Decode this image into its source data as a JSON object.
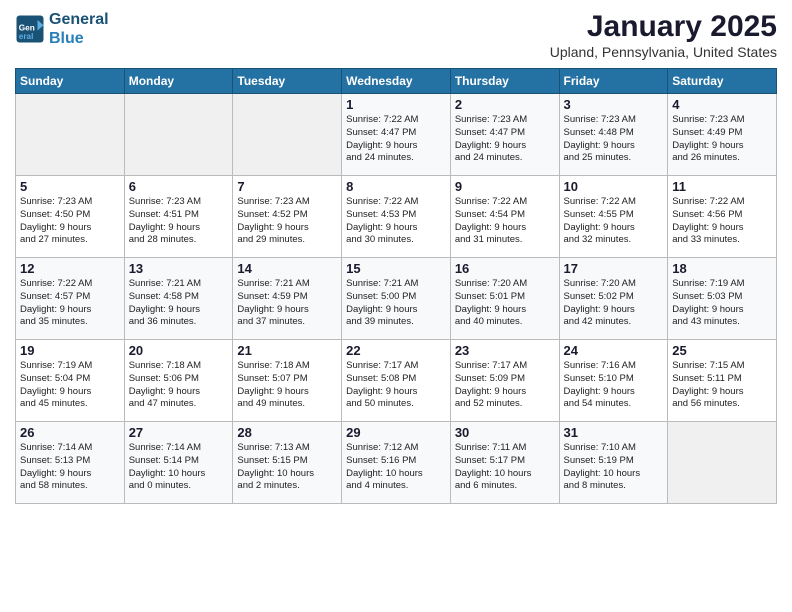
{
  "header": {
    "logo_line1": "General",
    "logo_line2": "Blue",
    "month_title": "January 2025",
    "location": "Upland, Pennsylvania, United States"
  },
  "weekdays": [
    "Sunday",
    "Monday",
    "Tuesday",
    "Wednesday",
    "Thursday",
    "Friday",
    "Saturday"
  ],
  "weeks": [
    [
      {
        "day": "",
        "info": ""
      },
      {
        "day": "",
        "info": ""
      },
      {
        "day": "",
        "info": ""
      },
      {
        "day": "1",
        "info": "Sunrise: 7:22 AM\nSunset: 4:47 PM\nDaylight: 9 hours\nand 24 minutes."
      },
      {
        "day": "2",
        "info": "Sunrise: 7:23 AM\nSunset: 4:47 PM\nDaylight: 9 hours\nand 24 minutes."
      },
      {
        "day": "3",
        "info": "Sunrise: 7:23 AM\nSunset: 4:48 PM\nDaylight: 9 hours\nand 25 minutes."
      },
      {
        "day": "4",
        "info": "Sunrise: 7:23 AM\nSunset: 4:49 PM\nDaylight: 9 hours\nand 26 minutes."
      }
    ],
    [
      {
        "day": "5",
        "info": "Sunrise: 7:23 AM\nSunset: 4:50 PM\nDaylight: 9 hours\nand 27 minutes."
      },
      {
        "day": "6",
        "info": "Sunrise: 7:23 AM\nSunset: 4:51 PM\nDaylight: 9 hours\nand 28 minutes."
      },
      {
        "day": "7",
        "info": "Sunrise: 7:23 AM\nSunset: 4:52 PM\nDaylight: 9 hours\nand 29 minutes."
      },
      {
        "day": "8",
        "info": "Sunrise: 7:22 AM\nSunset: 4:53 PM\nDaylight: 9 hours\nand 30 minutes."
      },
      {
        "day": "9",
        "info": "Sunrise: 7:22 AM\nSunset: 4:54 PM\nDaylight: 9 hours\nand 31 minutes."
      },
      {
        "day": "10",
        "info": "Sunrise: 7:22 AM\nSunset: 4:55 PM\nDaylight: 9 hours\nand 32 minutes."
      },
      {
        "day": "11",
        "info": "Sunrise: 7:22 AM\nSunset: 4:56 PM\nDaylight: 9 hours\nand 33 minutes."
      }
    ],
    [
      {
        "day": "12",
        "info": "Sunrise: 7:22 AM\nSunset: 4:57 PM\nDaylight: 9 hours\nand 35 minutes."
      },
      {
        "day": "13",
        "info": "Sunrise: 7:21 AM\nSunset: 4:58 PM\nDaylight: 9 hours\nand 36 minutes."
      },
      {
        "day": "14",
        "info": "Sunrise: 7:21 AM\nSunset: 4:59 PM\nDaylight: 9 hours\nand 37 minutes."
      },
      {
        "day": "15",
        "info": "Sunrise: 7:21 AM\nSunset: 5:00 PM\nDaylight: 9 hours\nand 39 minutes."
      },
      {
        "day": "16",
        "info": "Sunrise: 7:20 AM\nSunset: 5:01 PM\nDaylight: 9 hours\nand 40 minutes."
      },
      {
        "day": "17",
        "info": "Sunrise: 7:20 AM\nSunset: 5:02 PM\nDaylight: 9 hours\nand 42 minutes."
      },
      {
        "day": "18",
        "info": "Sunrise: 7:19 AM\nSunset: 5:03 PM\nDaylight: 9 hours\nand 43 minutes."
      }
    ],
    [
      {
        "day": "19",
        "info": "Sunrise: 7:19 AM\nSunset: 5:04 PM\nDaylight: 9 hours\nand 45 minutes."
      },
      {
        "day": "20",
        "info": "Sunrise: 7:18 AM\nSunset: 5:06 PM\nDaylight: 9 hours\nand 47 minutes."
      },
      {
        "day": "21",
        "info": "Sunrise: 7:18 AM\nSunset: 5:07 PM\nDaylight: 9 hours\nand 49 minutes."
      },
      {
        "day": "22",
        "info": "Sunrise: 7:17 AM\nSunset: 5:08 PM\nDaylight: 9 hours\nand 50 minutes."
      },
      {
        "day": "23",
        "info": "Sunrise: 7:17 AM\nSunset: 5:09 PM\nDaylight: 9 hours\nand 52 minutes."
      },
      {
        "day": "24",
        "info": "Sunrise: 7:16 AM\nSunset: 5:10 PM\nDaylight: 9 hours\nand 54 minutes."
      },
      {
        "day": "25",
        "info": "Sunrise: 7:15 AM\nSunset: 5:11 PM\nDaylight: 9 hours\nand 56 minutes."
      }
    ],
    [
      {
        "day": "26",
        "info": "Sunrise: 7:14 AM\nSunset: 5:13 PM\nDaylight: 9 hours\nand 58 minutes."
      },
      {
        "day": "27",
        "info": "Sunrise: 7:14 AM\nSunset: 5:14 PM\nDaylight: 10 hours\nand 0 minutes."
      },
      {
        "day": "28",
        "info": "Sunrise: 7:13 AM\nSunset: 5:15 PM\nDaylight: 10 hours\nand 2 minutes."
      },
      {
        "day": "29",
        "info": "Sunrise: 7:12 AM\nSunset: 5:16 PM\nDaylight: 10 hours\nand 4 minutes."
      },
      {
        "day": "30",
        "info": "Sunrise: 7:11 AM\nSunset: 5:17 PM\nDaylight: 10 hours\nand 6 minutes."
      },
      {
        "day": "31",
        "info": "Sunrise: 7:10 AM\nSunset: 5:19 PM\nDaylight: 10 hours\nand 8 minutes."
      },
      {
        "day": "",
        "info": ""
      }
    ]
  ]
}
